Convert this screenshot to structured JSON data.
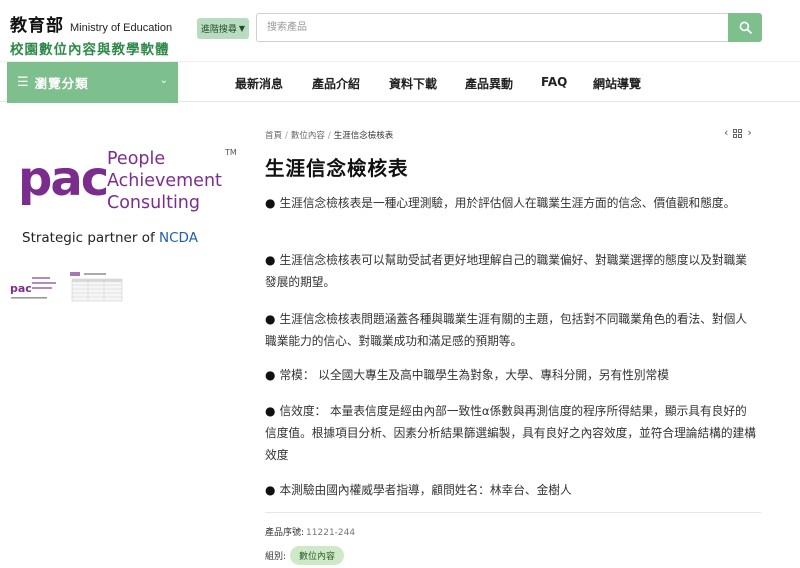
{
  "header": {
    "logo_cn": "教育部",
    "logo_en": "Ministry of Education",
    "logo_sub": "校園數位內容與教學軟體",
    "advanced_search_label": "進階搜尋",
    "search_placeholder": "搜索產品"
  },
  "nav": {
    "browse_label": "瀏覽分類",
    "items": [
      "最新消息",
      "產品介紹",
      "資料下載",
      "產品異動",
      "FAQ",
      "網站導覽"
    ]
  },
  "product_image": {
    "brand_mark": "pac",
    "brand_lines": [
      "People",
      "Achievement",
      "Consulting"
    ],
    "trademark": "TM",
    "tagline_prefix": "Strategic partner of ",
    "tagline_org": "NCDA"
  },
  "breadcrumb": [
    "首頁",
    "數位內容",
    "生涯信念檢核表"
  ],
  "title": "生涯信念檢核表",
  "paragraphs": [
    "生涯信念檢核表是一種心理測驗，用於評估個人在職業生涯方面的信念、價值觀和態度。",
    "生涯信念檢核表可以幫助受試者更好地理解自己的職業偏好、對職業選擇的態度以及對職業發展的期望。",
    "生涯信念檢核表問題涵蓋各種與職業生涯有關的主題，包括對不同職業角色的看法、對個人職業能力的信心、對職業成功和滿足感的預期等。",
    "常模： 以全國大專生及高中職學生為對象，大學、專科分開，另有性別常模",
    "信效度： 本量表信度是經由內部一致性α係數與再測信度的程序所得結果，顯示具有良好的信度值。根據項目分析、因素分析結果篩選編製，具有良好之內容效度，並符合理論結構的建構效度",
    "本測驗由國內權威學者指導，顧問姓名：林幸台、金樹人"
  ],
  "meta": {
    "serial_label": "產品序號:",
    "serial_value": "11221-244",
    "group_label": "組別:",
    "group_tag": "數位內容"
  },
  "colors": {
    "brand_green": "#7ec08d",
    "logo_purple": "#7b2d8e",
    "ncda_blue": "#1e5fa8"
  }
}
